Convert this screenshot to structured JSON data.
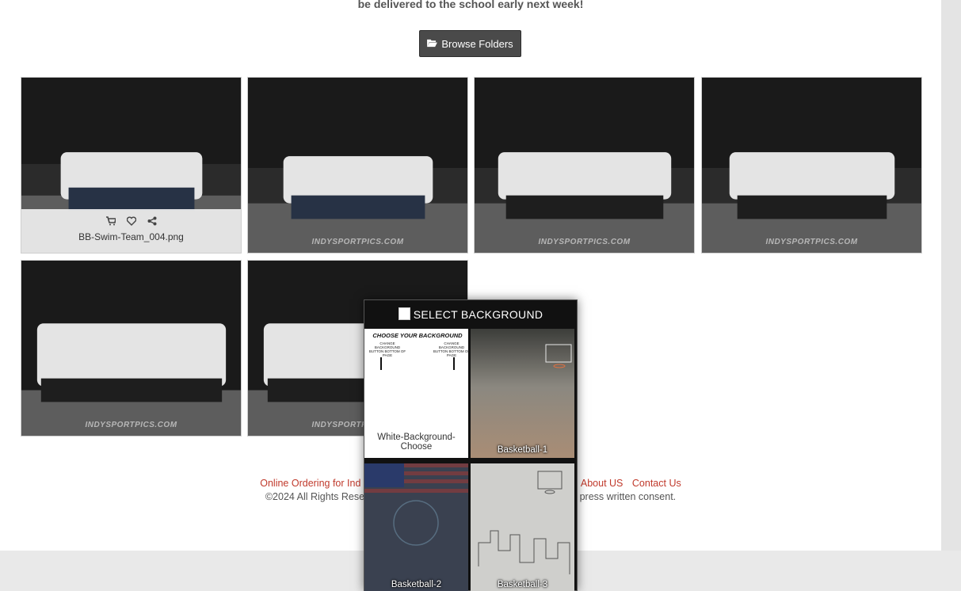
{
  "notice": {
    "text": "be delivered to the school early next week!"
  },
  "browse": {
    "label": "Browse Folders",
    "icon": "folder-open-icon"
  },
  "gallery": {
    "watermark": "INDYSPORTPICS.COM",
    "hover": {
      "filename": "BB-Swim-Team_004.png",
      "icons": [
        "cart-icon",
        "heart-icon",
        "share-icon"
      ]
    }
  },
  "footer": {
    "links": [
      "Online Ordering for Ind",
      "About US",
      "Contact Us"
    ],
    "copyright_left": "©2024 All Rights Rese",
    "copyright_right": "press written consent.",
    "link_color": "#c0392b"
  },
  "modal": {
    "title": "SELECT BACKGROUND",
    "backgrounds": [
      {
        "name": "White-Background-Choose",
        "banner": "CHOOSE YOUR BACKGROUND",
        "note_left": "CHANGE BACKGROUND BUTTON BOTTOM OF PAGE",
        "note_right": "CHANGE BACKGROUND BUTTON BOTTOM OF PAGE"
      },
      {
        "name": "Basketball-1"
      },
      {
        "name": "Basketball-2"
      },
      {
        "name": "Basketball-3"
      }
    ]
  },
  "colors": {
    "button_bg": "#4a4a4a",
    "modal_bg": "#111111",
    "page_bg": "#ffffff",
    "outer_bg": "#e9e9e9"
  }
}
